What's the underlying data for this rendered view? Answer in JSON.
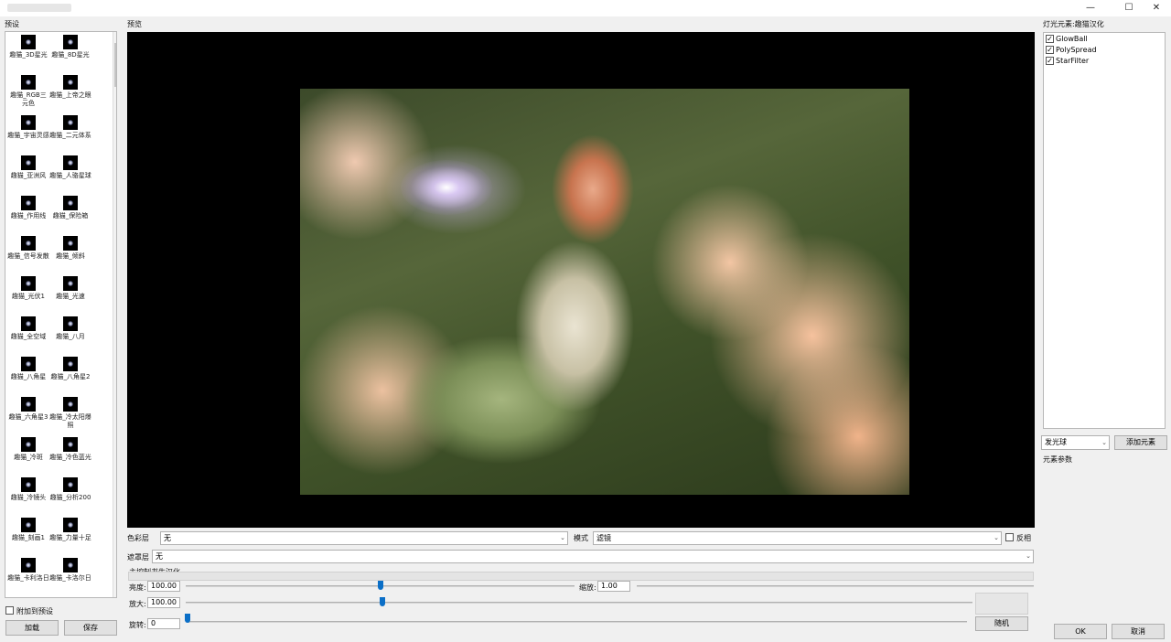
{
  "window": {
    "title": "",
    "minimize": "—",
    "maximize": "☐",
    "close": "✕"
  },
  "left_panel": {
    "label": "预设",
    "presets": [
      "趣猫_3D星光",
      "趣猫_8D星光",
      "趣猫_RGB三元色",
      "趣猫_上帝之眼",
      "趣猫_宇宙灵感",
      "趣猫_二元体系",
      "趣猫_亚洲风",
      "趣猫_人骆星球",
      "趣猫_作用线",
      "趣猫_保险箱",
      "趣猫_信号发散",
      "趣猫_倾斜",
      "趣猫_光伏1",
      "趣猫_光速",
      "趣猫_全空域",
      "趣猫_八月",
      "趣猫_八角星",
      "趣猫_八角星2",
      "趣猫_六角星3",
      "趣猫_冷太阳爆照",
      "趣猫_冷斑",
      "趣猫_冷色蓝光",
      "趣猫_冷镜头",
      "趣猫_分析200",
      "趣猫_刻画1",
      "趣猫_力量十足",
      "趣猫_卡利洛日",
      "趣猫_卡洛尔日"
    ],
    "append_preset_label": "附加到预设",
    "load_button": "加载",
    "save_button": "保存"
  },
  "preview": {
    "label": "预览"
  },
  "controls": {
    "color_layer_label": "色彩层",
    "color_layer_value": "无",
    "mode_label": "模式",
    "mode_value": "滤镜",
    "invert_label": "反相",
    "mask_layer_label": "遮罩层",
    "mask_layer_value": "无",
    "section_label": "主控制书生汉化",
    "brightness_label": "亮度:",
    "brightness_value": "100.00",
    "scale_label": "缩放:",
    "scale_value": "1.00",
    "zoom_label": "放大:",
    "zoom_value": "100.00",
    "rotate_label": "旋转:",
    "rotate_value": "0",
    "random_button": "随机",
    "brightness_slider_fraction": 0.5,
    "zoom_slider_fraction": 0.25,
    "rotate_slider_fraction": 0.0
  },
  "right_panel": {
    "label": "灯光元素:趣猫汉化",
    "elements": [
      {
        "name": "GlowBall",
        "checked": "✓"
      },
      {
        "name": "PolySpread",
        "checked": "✓"
      },
      {
        "name": "StarFilter",
        "checked": "✓"
      }
    ],
    "element_type_value": "发光球",
    "add_element_button": "添加元素",
    "element_params_label": "元素参数",
    "ok_button": "OK",
    "cancel_button": "取消"
  },
  "colors": {
    "slider_knob": "#0b6fc7",
    "preview_bg": "#000000"
  }
}
